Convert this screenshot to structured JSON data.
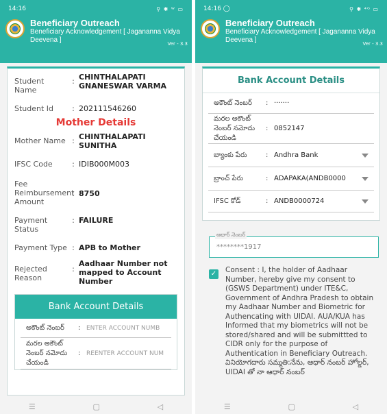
{
  "left": {
    "status": {
      "time": "14:16",
      "icons": "⚲ ✱ ᵂ ▭"
    },
    "header": {
      "title": "Beneficiary Outreach",
      "subtitle": "Beneficiary Acknowledgement [ Jagananna Vidya Deevena ]",
      "version": "Ver - 3.3"
    },
    "student": [
      {
        "label": "Student Name",
        "value": "CHINTHALAPATI GNANESWAR VARMA",
        "bold": true
      },
      {
        "label": "Student Id",
        "value": "202111546260",
        "bold": false
      }
    ],
    "mother_title": "Mother Details",
    "mother": [
      {
        "label": "Mother Name",
        "value": "CHINTHALAPATI SUNITHA",
        "bold": true
      },
      {
        "label": "IFSC Code",
        "value": "IDIB000M003",
        "bold": false
      },
      {
        "label": "Fee Reimbursement Amount",
        "value": "8750",
        "bold": true
      },
      {
        "label": "Payment Status",
        "value": "FAILURE",
        "bold": true
      },
      {
        "label": "Payment Type",
        "value": "APB to Mother",
        "bold": true
      },
      {
        "label": "Rejected Reason",
        "value": "Aadhaar Number not mapped to Account Number",
        "bold": true
      }
    ],
    "bank": {
      "title": "Bank Account Details",
      "account_label": "అకౌంట్ నెంబర్",
      "account_placeholder": "ENTER ACCOUNT NUMB",
      "reenter_label": "మరల అకౌంట్ నెంబర్ నమోదు చేయండి",
      "reenter_placeholder": "REENTER ACCOUNT NUM"
    },
    "nav": {
      "menu": "☰",
      "home": "▢",
      "back": "◁"
    }
  },
  "right": {
    "status": {
      "time": "14:16 ◯",
      "icons": "⚲ ✱ ⁴ᴳ ▭"
    },
    "header": {
      "title": "Beneficiary Outreach",
      "subtitle": "Beneficiary Acknowledgement [ Jagananna Vidya Deevena ]",
      "version": "Ver - 3.3"
    },
    "bank": {
      "title": "Bank Account Details",
      "account_label": "అకౌంట్ నెంబర్",
      "account_value": "·······",
      "reenter_label": "మరల అకౌంట్ నెంబర్ నమోదు చేయండి",
      "reenter_value": "0852147",
      "bank_name_label": "బ్యాంకు పేరు",
      "bank_name_value": "Andhra Bank",
      "branch_label": "బ్రాంచ్ పేరు",
      "branch_value": "ADAPAKA(ANDB0000",
      "ifsc_label": "IFSC కోడ్",
      "ifsc_value": "ANDB0000724"
    },
    "aadhaar": {
      "label": "ఆధార్ నెంబర్",
      "value": "********1917"
    },
    "consent": "Consent : I, the holder of Aadhaar Number, hereby give my consent to (GSWS Department) under ITE&C, Government of Andhra Pradesh to obtain my Aadhaar Number and Biometric for Authencating with UIDAI. AUA/KUA has Informed that my biometrics will not be stored/shared and will be submittted to CIDR only for the purpose of Authentication in Beneficiary Outreach. వినియోగదారు సమ్మతి:నేను, ఆధార్ నంబర్ హోల్డర్, UIDAI తో నా ఆధార్ నంబర్",
    "nav": {
      "menu": "☰",
      "home": "▢",
      "back": "◁"
    }
  },
  "colors": {
    "accent": "#2bb3a5",
    "mother_title": "#e53935"
  }
}
